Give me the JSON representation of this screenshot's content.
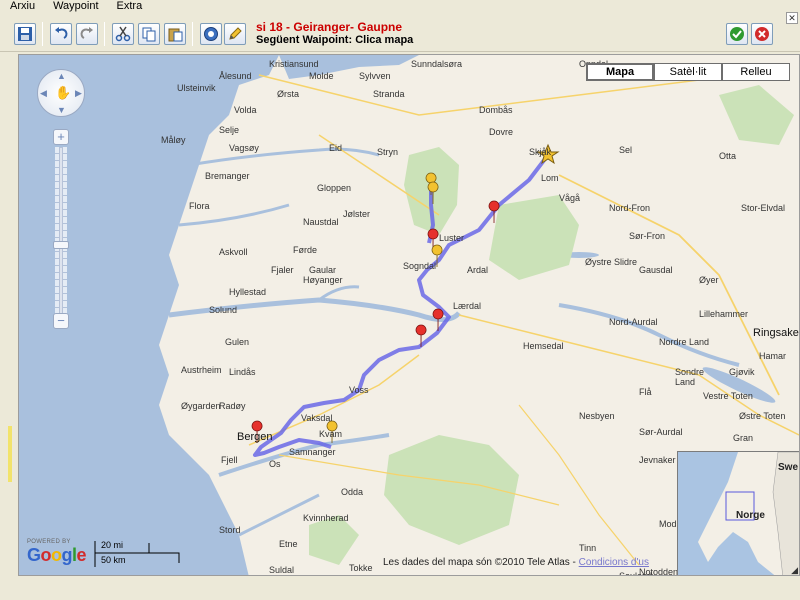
{
  "menu": [
    "Arxiu",
    "Waypoint",
    "Extra"
  ],
  "route": {
    "title": "si 18 - Geiranger- Gaupne",
    "subtitle": "Següent Waipoint: Clica mapa"
  },
  "toolbar_icons": [
    "save-icon",
    "undo-icon",
    "redo-icon",
    "cut-icon",
    "copy-icon",
    "paste-icon",
    "target-icon",
    "pencil-icon",
    "ok-icon",
    "cancel-icon"
  ],
  "map_types": [
    "Mapa",
    "Satèl·lit",
    "Relleu"
  ],
  "places": [
    {
      "name": "Kristiansund",
      "c": "place"
    },
    {
      "name": "Sunndalsøra",
      "c": "place"
    },
    {
      "name": "Oppdal",
      "c": "place"
    },
    {
      "name": "Ålesund",
      "c": "place"
    },
    {
      "name": "Molde",
      "c": "place"
    },
    {
      "name": "Sylvven",
      "c": "place"
    },
    {
      "name": "Ulsteinvik",
      "c": "place"
    },
    {
      "name": "Ørsta",
      "c": "place"
    },
    {
      "name": "Stranda",
      "c": "place"
    },
    {
      "name": "Volda",
      "c": "place"
    },
    {
      "name": "Dombås",
      "c": "place"
    },
    {
      "name": "Selje",
      "c": "place"
    },
    {
      "name": "Måløy",
      "c": "place"
    },
    {
      "name": "Vagsøy",
      "c": "place"
    },
    {
      "name": "Eid",
      "c": "place"
    },
    {
      "name": "Stryn",
      "c": "place"
    },
    {
      "name": "Dovre",
      "c": "place"
    },
    {
      "name": "Sel",
      "c": "place"
    },
    {
      "name": "Skjåk",
      "c": "place"
    },
    {
      "name": "Lom",
      "c": "place"
    },
    {
      "name": "Otta",
      "c": "place"
    },
    {
      "name": "Bremanger",
      "c": "place"
    },
    {
      "name": "Gloppen",
      "c": "place"
    },
    {
      "name": "Vågå",
      "c": "place"
    },
    {
      "name": "Nord-Fron",
      "c": "place"
    },
    {
      "name": "Flora",
      "c": "place"
    },
    {
      "name": "Naustdal",
      "c": "place"
    },
    {
      "name": "Jølster",
      "c": "place"
    },
    {
      "name": "Stor-Elvdal",
      "c": "place"
    },
    {
      "name": "Førde",
      "c": "place"
    },
    {
      "name": "Askvoll",
      "c": "place"
    },
    {
      "name": "Luster",
      "c": "place"
    },
    {
      "name": "Sør-Fron",
      "c": "place"
    },
    {
      "name": "Gaular",
      "c": "place"
    },
    {
      "name": "Høyanger",
      "c": "place"
    },
    {
      "name": "Fjaler",
      "c": "place"
    },
    {
      "name": "Sogndal",
      "c": "place"
    },
    {
      "name": "Ardal",
      "c": "place"
    },
    {
      "name": "Øystre Slidre",
      "c": "place"
    },
    {
      "name": "Gausdal",
      "c": "place"
    },
    {
      "name": "Øyer",
      "c": "place"
    },
    {
      "name": "Hyllestad",
      "c": "place"
    },
    {
      "name": "Lærdal",
      "c": "place"
    },
    {
      "name": "Lillehammer",
      "c": "place"
    },
    {
      "name": "Nord-Aurdal",
      "c": "place"
    },
    {
      "name": "Nordre Land",
      "c": "place"
    },
    {
      "name": "Ringsaker",
      "c": "place big"
    },
    {
      "name": "Solund",
      "c": "place"
    },
    {
      "name": "Gulen",
      "c": "place"
    },
    {
      "name": "Hemsedal",
      "c": "place"
    },
    {
      "name": "Hamar",
      "c": "place"
    },
    {
      "name": "Austrheim",
      "c": "place"
    },
    {
      "name": "Lindås",
      "c": "place"
    },
    {
      "name": "Sondre",
      "c": "place"
    },
    {
      "name": "Land",
      "c": "place"
    },
    {
      "name": "Gjøvik",
      "c": "place"
    },
    {
      "name": "Voss",
      "c": "place"
    },
    {
      "name": "Flå",
      "c": "place"
    },
    {
      "name": "Vestre Toten",
      "c": "place"
    },
    {
      "name": "Øygarden",
      "c": "place"
    },
    {
      "name": "Radøy",
      "c": "place"
    },
    {
      "name": "Nesbyen",
      "c": "place"
    },
    {
      "name": "Østre Toten",
      "c": "place"
    },
    {
      "name": "Fjell",
      "c": "place"
    },
    {
      "name": "Vaksdal",
      "c": "place"
    },
    {
      "name": "Sør-Aurdal",
      "c": "place"
    },
    {
      "name": "Gran",
      "c": "place"
    },
    {
      "name": "Bergen",
      "c": "place big"
    },
    {
      "name": "Kvam",
      "c": "place"
    },
    {
      "name": "Os",
      "c": "place"
    },
    {
      "name": "Samnanger",
      "c": "place"
    },
    {
      "name": "Jevnaker",
      "c": "place"
    },
    {
      "name": "Odda",
      "c": "place"
    },
    {
      "name": "Kvinnherad",
      "c": "place"
    },
    {
      "name": "Modum",
      "c": "place"
    },
    {
      "name": "Stord",
      "c": "place"
    },
    {
      "name": "Etne",
      "c": "place"
    },
    {
      "name": "Tinn",
      "c": "place"
    },
    {
      "name": "Kongsberg",
      "c": "place"
    },
    {
      "name": "Suldal",
      "c": "place"
    },
    {
      "name": "Tokke",
      "c": "place"
    },
    {
      "name": "Notodden",
      "c": "place"
    },
    {
      "name": "Sauland",
      "c": "place"
    }
  ],
  "overview": {
    "country": "Norge",
    "neighbour": "Swe"
  },
  "scale": {
    "miles": "20 mi",
    "km": "50 km"
  },
  "logo": {
    "powered": "POWERED BY",
    "word": "Google"
  },
  "attribution": {
    "text": "Les dades del mapa són ©2010 Tele Atlas - ",
    "link": "Condicions d'us"
  }
}
